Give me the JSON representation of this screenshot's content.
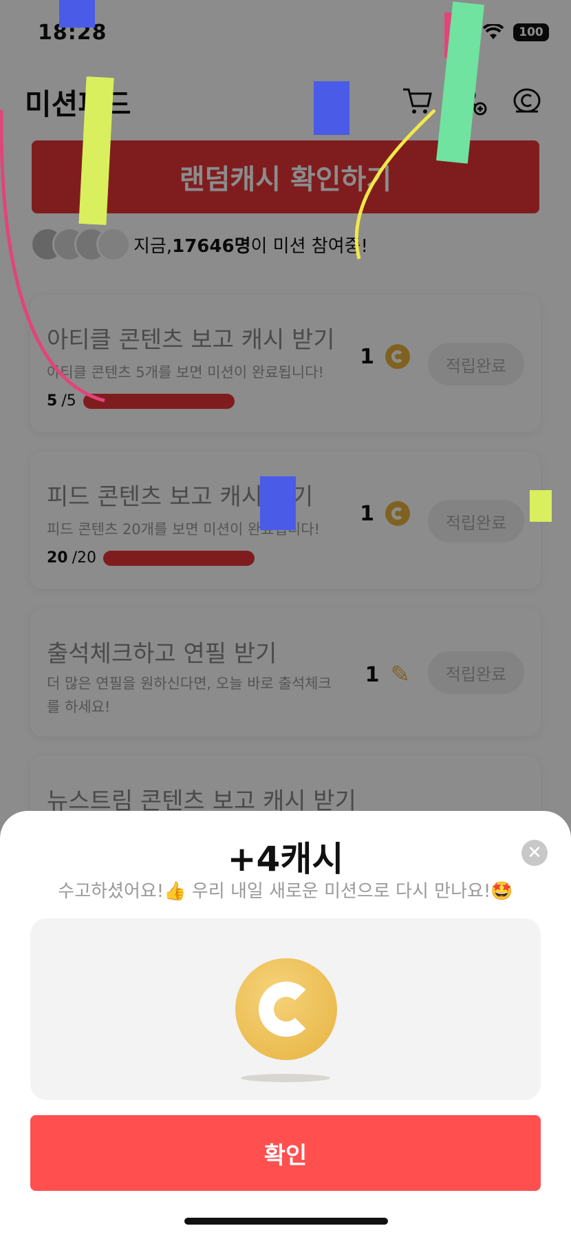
{
  "status": {
    "time": "18:28",
    "battery": "100"
  },
  "header": {
    "title": "미션피드"
  },
  "random_cash_button": "랜덤캐시 확인하기",
  "participants": {
    "prefix": "지금, ",
    "count": "17646명",
    "suffix": "이 미션 참여중!"
  },
  "missions": [
    {
      "title": "아티클 콘텐츠 보고 캐시 받기",
      "desc": "아티클 콘텐츠 5개를 보면 미션이 완료됩니다!",
      "progress_done": "5",
      "progress_total": "/5",
      "progress_fraction": 1.0,
      "reward": "1",
      "reward_icon": "coin-icon",
      "button": "적립완료"
    },
    {
      "title": "피드 콘텐츠 보고 캐시 받기",
      "desc": "피드 콘텐츠 20개를 보면 미션이 완료됩니다!",
      "progress_done": "20",
      "progress_total": "/20",
      "progress_fraction": 1.0,
      "reward": "1",
      "reward_icon": "coin-icon",
      "button": "적립완료"
    },
    {
      "title": "출석체크하고 연필 받기",
      "desc": "더 많은 연필을 원하신다면, 오늘 바로 출석체크를 하세요!",
      "reward": "1",
      "reward_icon": "pencil-icon",
      "button": "적립완료"
    },
    {
      "title": "뉴스트림 콘텐츠 보고 캐시 받기"
    }
  ],
  "sheet": {
    "title": "+4캐시",
    "subtitle": "수고하셨어요!👍 우리 내일 새로운 미션으로 다시 만나요!🤩",
    "confirm": "확인"
  },
  "colors": {
    "accent": "#e73538",
    "confirm": "#ff4f4f",
    "coin": "#e9b23b"
  }
}
